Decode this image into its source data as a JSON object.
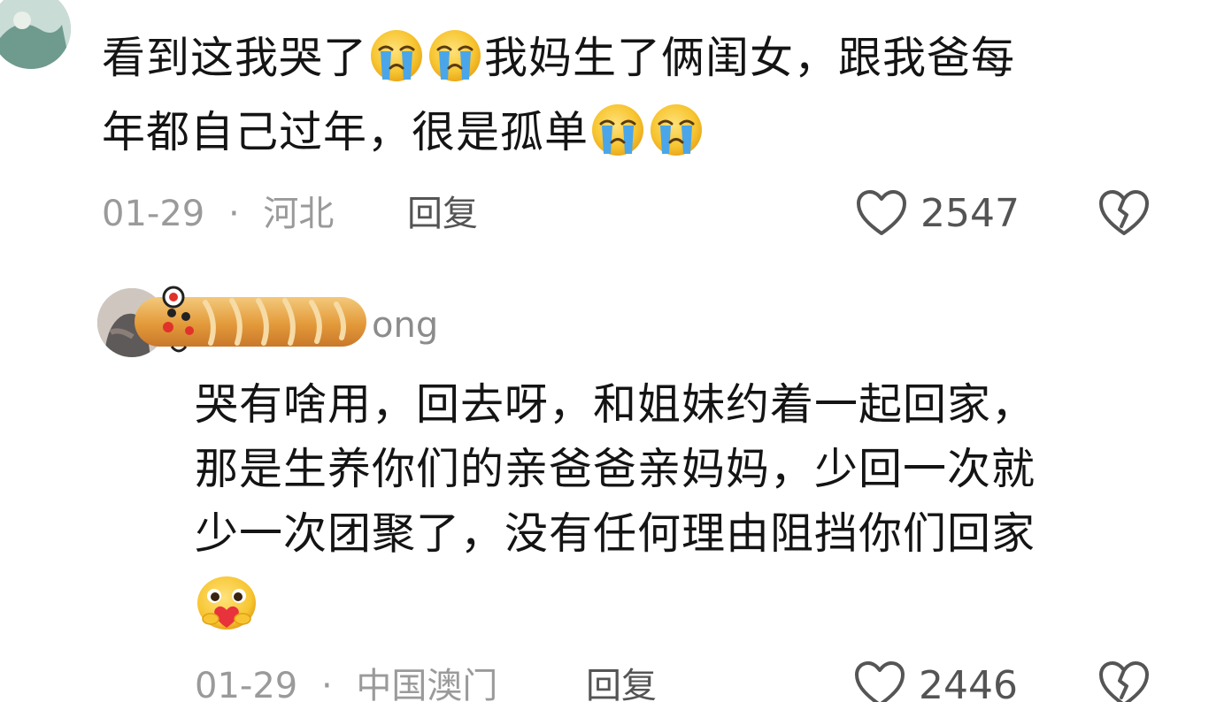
{
  "comments": [
    {
      "avatar": "avatar-image",
      "text_lines": [
        "看到这我哭了",
        "我妈生了俩闺女，跟我爸每",
        "年都自己过年，很是孤单"
      ],
      "emojis": [
        "crying-emoji",
        "crying-emoji",
        "crying-emoji",
        "crying-emoji"
      ],
      "date": "01-29",
      "separator": "·",
      "location": "河北",
      "reply_label": "回复",
      "likes": "2547"
    },
    {
      "avatar": "avatar-image",
      "username_visible": "ong",
      "text_lines": [
        "哭有啥用，回去呀，和姐妹约着一起回家，",
        "那是生养你们的亲爸爸亲妈妈，少回一次就",
        "少一次团聚了，没有任何理由阻挡你们回家"
      ],
      "emojis": [
        "heart-hug-emoji"
      ],
      "date": "01-29",
      "separator": "·",
      "location": "中国澳门",
      "reply_label": "回复",
      "likes": "2446"
    }
  ],
  "icons": {
    "like": "heart-outline-icon",
    "dislike": "broken-heart-icon",
    "emoji_yellow": "#f7c531",
    "emoji_tear": "#4aa6e8"
  }
}
